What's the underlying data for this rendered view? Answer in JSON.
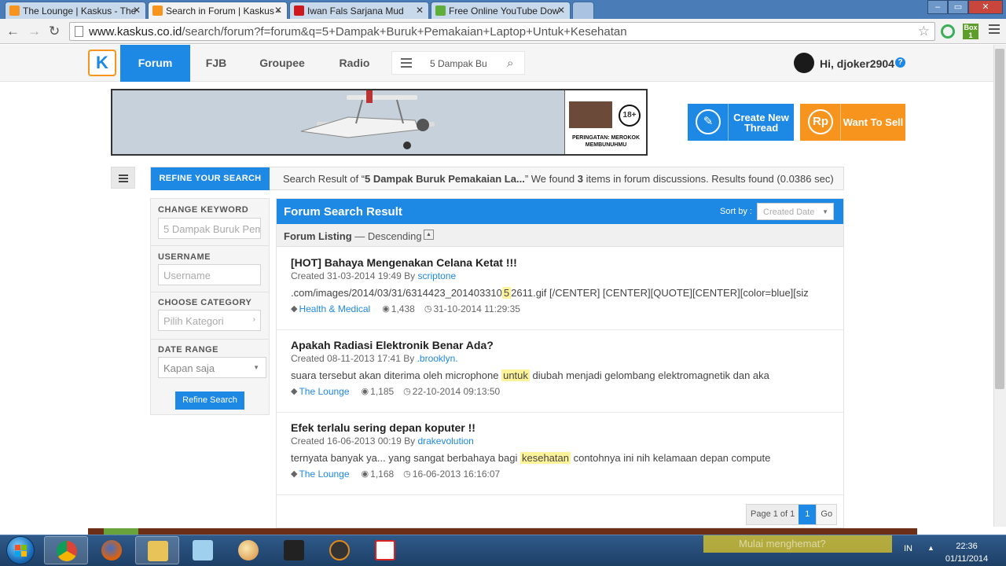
{
  "browser": {
    "tabs": [
      {
        "title": "The Lounge | Kaskus - The",
        "active": false
      },
      {
        "title": "Search in Forum | Kaskus -",
        "active": true
      },
      {
        "title": "Iwan Fals Sarjana Mud",
        "active": false
      },
      {
        "title": "Free Online YouTube Dow",
        "active": false
      }
    ],
    "url_host": "www.kaskus.co.id",
    "url_path": "/search/forum?f=forum&q=5+Dampak+Buruk+Pemakaian+Laptop+Untuk+Kesehatan",
    "ext_badge": "Box",
    "ext_count": "1"
  },
  "header": {
    "nav": [
      "Forum",
      "FJB",
      "Groupee",
      "Radio"
    ],
    "active_nav": "Forum",
    "search_value": "5 Dampak Bu",
    "greeting": "Hi, djoker2904",
    "help": "?"
  },
  "banner": {
    "age_badge": "18+",
    "warning": "PERINGATAN: MEROKOK MEMBUNUHMU"
  },
  "actions": {
    "create_thread": "Create New Thread",
    "want_to_sell": "Want To Sell",
    "sell_icon": "Rp"
  },
  "refine": {
    "tab_label": "REFINE YOUR SEARCH",
    "summary_prefix": "Search Result of “",
    "summary_query": "5 Dampak Buruk Pemakaian La...",
    "summary_mid": "” We found ",
    "summary_count": "3",
    "summary_suffix": " items in forum discussions. Results found (0.0386 sec)"
  },
  "filters": {
    "keyword_label": "CHANGE KEYWORD",
    "keyword_value": "5 Dampak Buruk Pem",
    "username_label": "USERNAME",
    "username_placeholder": "Username",
    "category_label": "CHOOSE CATEGORY",
    "category_placeholder": "Pilih Kategori",
    "daterange_label": "DATE RANGE",
    "daterange_value": "Kapan saja",
    "refine_button": "Refine Search"
  },
  "results": {
    "title": "Forum Search Result",
    "sort_label": "Sort by :",
    "sort_value": "Created Date",
    "listing_label": "Forum Listing",
    "listing_order": "— Descending",
    "items": [
      {
        "title": "[HOT] Bahaya Mengenakan Celana Ketat !!!",
        "created": "Created 31-03-2014 19:49 By ",
        "author": "scriptone",
        "snippet_before": ".com/images/2014/03/31/6314423_201403310",
        "snippet_hl": "5",
        "snippet_after": "2611.gif [/CENTER] [CENTER][QUOTE][CENTER][color=blue][siz",
        "category": "Health & Medical",
        "views": "1,438",
        "last": "31-10-2014 11:29:35"
      },
      {
        "title": "Apakah Radiasi Elektronik Benar Ada?",
        "created": "Created 08-11-2013 17:41 By ",
        "author": ".brooklyn.",
        "snippet_before": "suara tersebut akan diterima oleh microphone ",
        "snippet_hl": "untuk",
        "snippet_after": " diubah menjadi gelombang elektromagnetik dan aka",
        "category": "The Lounge",
        "views": "1,185",
        "last": "22-10-2014 09:13:50"
      },
      {
        "title": "Efek terlalu sering depan koputer !!",
        "created": "Created 16-06-2013 00:19 By ",
        "author": "drakevolution",
        "snippet_before": "ternyata banyak ya... yang sangat berbahaya bagi ",
        "snippet_hl": "kesehatan",
        "snippet_after": " contohnya ini nih kelamaan depan compute",
        "category": "The Lounge",
        "views": "1,168",
        "last": "16-06-2013 16:16:07"
      }
    ],
    "pager": {
      "label": "Page 1 of 1",
      "current": "1",
      "go": "Go"
    }
  },
  "taskbar": {
    "lang": "IN",
    "time": "22:36",
    "date": "01/11/2014",
    "background_text": "Mulai menghemat?"
  },
  "colors": {
    "kaskus_blue": "#1e88e5",
    "create_thread": "#1e88e5",
    "want_to_sell": "#f7941d",
    "highlight": "#fff399"
  }
}
